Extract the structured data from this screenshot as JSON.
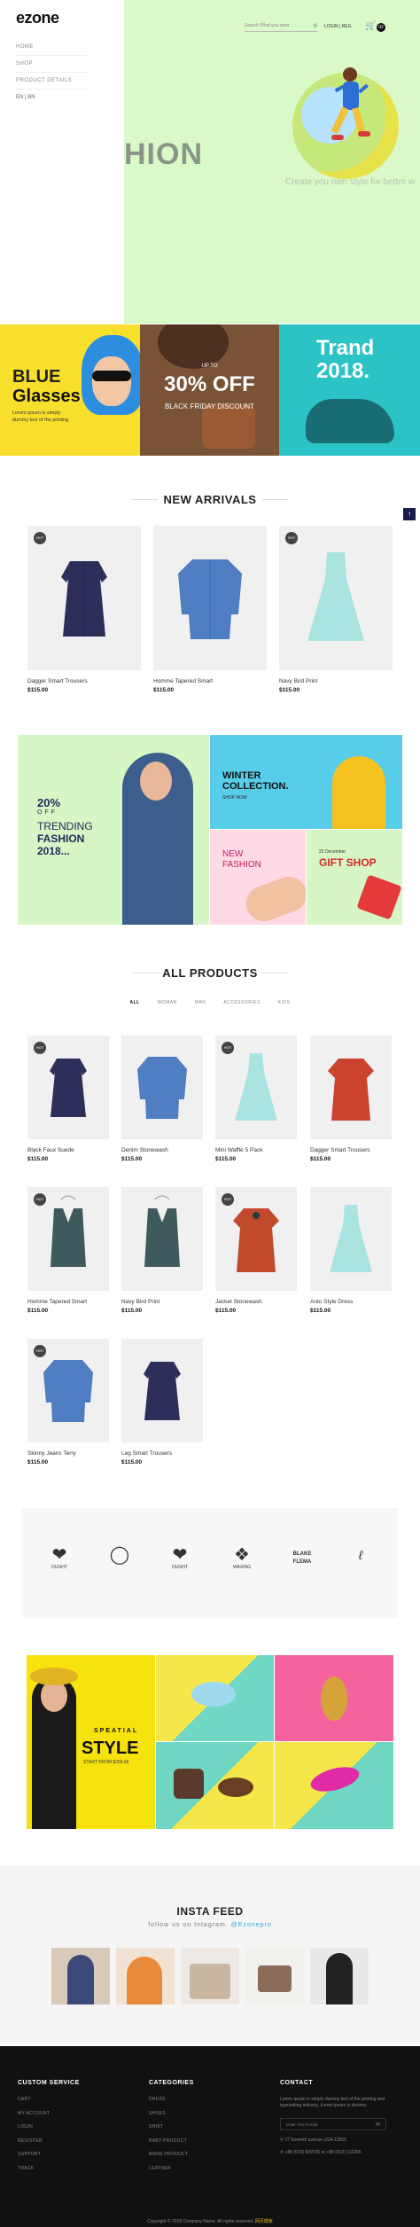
{
  "brand": {
    "logo": "ezone"
  },
  "nav": {
    "items": [
      "HOME",
      "SHOP",
      "PRODUCT DETAILS"
    ],
    "lang": "EN | BN"
  },
  "header": {
    "search_placeholder": "Search What you want",
    "auth": "LOGIN | REG",
    "cart_count": "02"
  },
  "hero": {
    "headline": "HION",
    "tagline": "Create you own style for better w"
  },
  "banners": {
    "b1": {
      "line1": "BLUE",
      "line2": "Glasses",
      "text": "Lorem ipsum is simply dummy text of the printing"
    },
    "b2": {
      "upto": "UP TO",
      "offer": "30% OFF",
      "sub": "BLACK FRIDAY DISCOUNT"
    },
    "b3": {
      "line1": "Trand",
      "line2": "2018."
    }
  },
  "new_arrivals": {
    "title": "NEW ARRIVALS",
    "badge": "HOT",
    "products": [
      {
        "name": "Dagger Smart Trousers",
        "price": "$115.00"
      },
      {
        "name": "Homme Tapered Smart",
        "price": "$115.00"
      },
      {
        "name": "Navy Bird Print",
        "price": "$115.00"
      }
    ]
  },
  "promo": {
    "p1": {
      "pct": "20%",
      "off": "OFF",
      "trending": "TRENDING",
      "fashion": "FASHION",
      "year": "2018..."
    },
    "p2": {
      "line1": "WINTER",
      "line2": "COLLECTION.",
      "shop": "SHOP NOW"
    },
    "p3": {
      "line1": "NEW",
      "line2": "FASHION"
    },
    "p4": {
      "date": "25 December",
      "title": "GIFT SHOP"
    }
  },
  "all_products": {
    "title": "ALL PRODUCTS",
    "tabs": [
      "ALL",
      "WOMAN",
      "MAN",
      "ACCESSORIES",
      "KIDS"
    ],
    "products": [
      {
        "name": "Black Faux Suede",
        "price": "$115.00"
      },
      {
        "name": "Denim Stonewash",
        "price": "$115.00"
      },
      {
        "name": "Mini Waffle 5 Pack",
        "price": "$115.00"
      },
      {
        "name": "Dagger Smart Trousers",
        "price": "$115.00"
      },
      {
        "name": "Homme Tapered Smart",
        "price": "$115.00"
      },
      {
        "name": "Navy Bird Print",
        "price": "$115.00"
      },
      {
        "name": "Jacket Stonewash",
        "price": "$115.00"
      },
      {
        "name": "Anto Style Dress",
        "price": "$115.00"
      },
      {
        "name": "Skinny Jeans Terry",
        "price": "$115.00"
      },
      {
        "name": "Leg Smart Trousers",
        "price": "$115.00"
      }
    ]
  },
  "brands": [
    "DUGHT",
    "",
    "DUGHT",
    "WAXING",
    "BLAKE FLEMA",
    ""
  ],
  "style_banner": {
    "pre": "SPEATIAL",
    "title": "STYLE",
    "sub": "START FROM $269.00"
  },
  "insta": {
    "title": "INSTA FEED",
    "follow": "follow us on Intagram.",
    "handle": "@Ezonepro"
  },
  "footer": {
    "col1": {
      "title": "CUSTOM SERVICE",
      "items": [
        "CART",
        "MY ACCOUNT",
        "LOGIN",
        "REGISTER",
        "SUPPORT",
        "TRACK"
      ]
    },
    "col2": {
      "title": "CATEGORIES",
      "items": [
        "DRESS",
        "SHOES",
        "SHIRT",
        "BABY PRODUCT",
        "MANS PRODUCT",
        "LEATHER"
      ]
    },
    "col3": {
      "title": "CONTACT",
      "text": "Lorem ipsum is simply dummy text of the printing and typesetting industry. Lorem ipsum is dummy.",
      "email_placeholder": "Enter Your E-mail",
      "address": "77 Seventh avenue USA 12555.",
      "phone": "+88 (015) 609735 or +88 (012) 112266"
    },
    "copyright": "Copyright © 2018 Company Name. All rights reserved.",
    "brand_glyphs": "网页模板"
  },
  "colors": {
    "hero_bg": "#d9f9c9",
    "dark": "#111111",
    "accent_yellow": "#f8df2c",
    "teal": "#2cc3c6"
  }
}
